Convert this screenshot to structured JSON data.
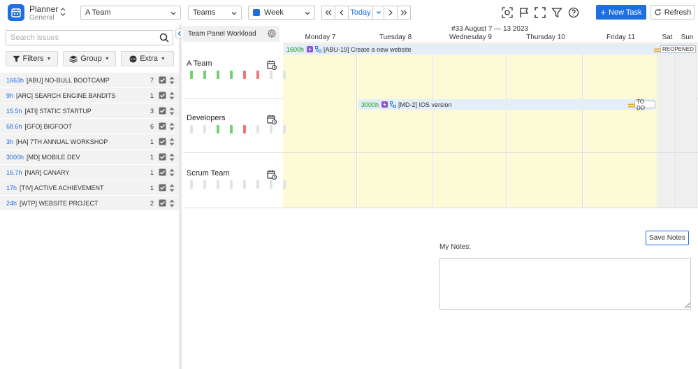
{
  "app": {
    "title": "Planner",
    "subtitle": "General"
  },
  "toolbar": {
    "team_select": "A Team",
    "group_select": "Teams",
    "view_select": "Week",
    "today_label": "Today",
    "new_task_label": "New Task",
    "refresh_label": "Refresh"
  },
  "sidebar": {
    "search_placeholder": "Search issues",
    "filters_label": "Filters",
    "group_label": "Group",
    "extra_label": "Extra",
    "projects": [
      {
        "hours": "1663h",
        "name": "[ABU] NO-BULL BOOTCAMP",
        "count": "7"
      },
      {
        "hours": "9h",
        "name": "[ARC] SEARCH ENGINE BANDITS",
        "count": "1"
      },
      {
        "hours": "15.5h",
        "name": "[ATI] STATIC STARTUP",
        "count": "3"
      },
      {
        "hours": "68.6h",
        "name": "[GFO] BIGFOOT",
        "count": "6"
      },
      {
        "hours": "3h",
        "name": "[HA] 7TH ANNUAL WORKSHOP",
        "count": "1"
      },
      {
        "hours": "3000h",
        "name": "[MD] MOBILE DEV",
        "count": "1"
      },
      {
        "hours": "16.7h",
        "name": "[NAR] CANARY",
        "count": "1"
      },
      {
        "hours": "17h",
        "name": "[TIV] ACTIVE ACHIEVEMENT",
        "count": "1"
      },
      {
        "hours": "24h",
        "name": "[WTP] WEBSITE PROJECT",
        "count": "2"
      }
    ]
  },
  "planner": {
    "panel_title": "Team Panel Workload",
    "week_label": "#33 August 7 — 13 2023",
    "days": [
      "Monday 7",
      "Tuesday 8",
      "Wednesday 9",
      "Thursday 10",
      "Friday 11",
      "Sat",
      "Sun"
    ],
    "teams": [
      {
        "name": "A Team",
        "workload": [
          "green",
          "green",
          "green",
          "green",
          "red",
          "red",
          "gray",
          "gray"
        ]
      },
      {
        "name": "Developers",
        "workload": [
          "gray",
          "gray",
          "green",
          "green",
          "red",
          "gray",
          "gray",
          "gray"
        ]
      },
      {
        "name": "Scrum Team",
        "workload": [
          "gray",
          "gray",
          "gray",
          "gray",
          "gray",
          "gray",
          "gray",
          "gray"
        ]
      }
    ],
    "tasks": [
      {
        "hours": "1600h",
        "title": "[ABU-19] Create a new website",
        "status": "REOPENED"
      },
      {
        "hours": "3000h",
        "title": "[MD-2] IOS version",
        "status": "TO DO"
      }
    ],
    "colors": {
      "workday_bg": "#fdfad8",
      "weekend_bg": "#efefef",
      "green": "#6fd36f",
      "red": "#ee7878",
      "gray": "#e2e2e2"
    }
  },
  "notes": {
    "label": "My Notes:",
    "save_label": "Save Notes",
    "value": ""
  }
}
